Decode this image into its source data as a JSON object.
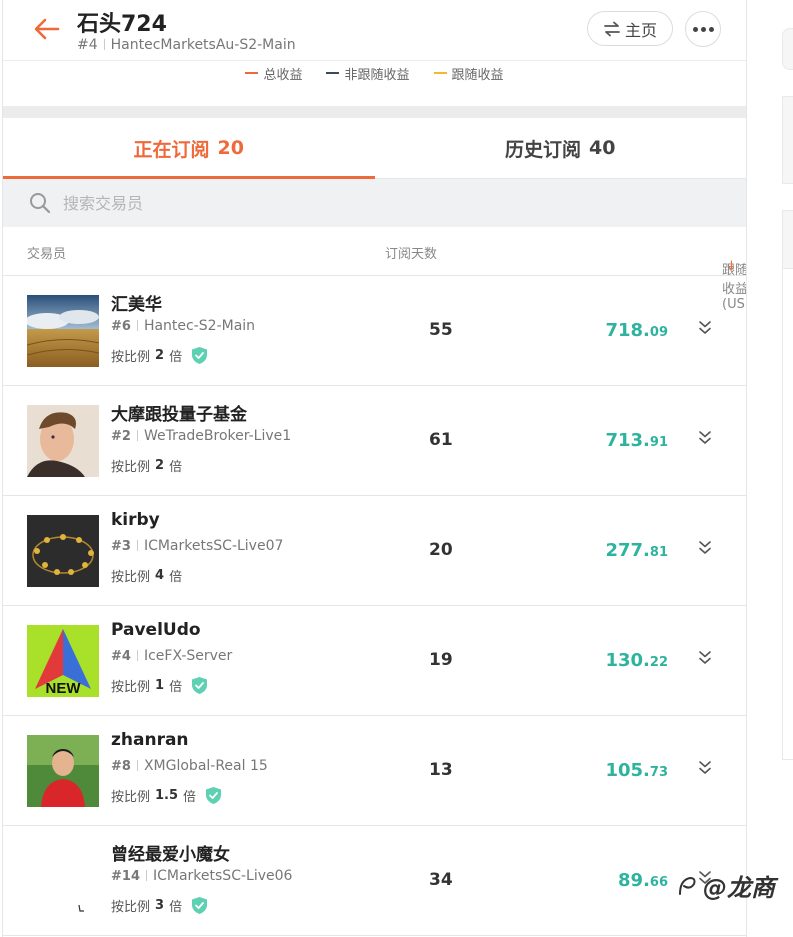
{
  "header": {
    "title": "石头724",
    "rank": "#4",
    "server": "HantecMarketsAu-S2-Main",
    "home_label": "主页"
  },
  "legend": [
    {
      "label": "总收益",
      "color": "#ef6a3a"
    },
    {
      "label": "非跟随收益",
      "color": "#3d4a5c"
    },
    {
      "label": "跟随收益",
      "color": "#f5b72e"
    }
  ],
  "tabs": [
    {
      "label": "正在订阅",
      "count": "20",
      "active": true
    },
    {
      "label": "历史订阅",
      "count": "40",
      "active": false
    }
  ],
  "search": {
    "placeholder": "搜索交易员"
  },
  "columns": {
    "trader": "交易员",
    "days": "订阅天数",
    "profit": "跟随收益 (USD)",
    "sort_arrow": "↓"
  },
  "rows": [
    {
      "name": "汇美华",
      "rank": "#6",
      "server": "Hantec-S2-Main",
      "ratio_prefix": "按比例",
      "ratio": "2",
      "ratio_suffix": "倍",
      "verified": true,
      "days": "55",
      "profit_int": "718.",
      "profit_dec": "09",
      "avatar": "wheat-field"
    },
    {
      "name": "大摩跟投量子基金",
      "rank": "#2",
      "server": "WeTradeBroker-Live1",
      "ratio_prefix": "按比例",
      "ratio": "2",
      "ratio_suffix": "倍",
      "verified": false,
      "days": "61",
      "profit_int": "713.",
      "profit_dec": "91",
      "avatar": "man-portrait"
    },
    {
      "name": "kirby",
      "rank": "#3",
      "server": "ICMarketsSC-Live07",
      "ratio_prefix": "按比例",
      "ratio": "4",
      "ratio_suffix": "倍",
      "verified": false,
      "days": "20",
      "profit_int": "277.",
      "profit_dec": "81",
      "avatar": "gold-pendants"
    },
    {
      "name": "PavelUdo",
      "rank": "#4",
      "server": "IceFX-Server",
      "ratio_prefix": "按比例",
      "ratio": "1",
      "ratio_suffix": "倍",
      "verified": true,
      "days": "19",
      "profit_int": "130.",
      "profit_dec": "22",
      "avatar": "new-triangle",
      "avatar_text": "NEW"
    },
    {
      "name": "zhanran",
      "rank": "#8",
      "server": "XMGlobal-Real 15",
      "ratio_prefix": "按比例",
      "ratio": "1.5",
      "ratio_suffix": "倍",
      "verified": true,
      "days": "13",
      "profit_int": "105.",
      "profit_dec": "73",
      "avatar": "man-red-shirt"
    },
    {
      "name": "曾经最爱小魔女",
      "rank": "#14",
      "server": "ICMarketsSC-Live06",
      "ratio_prefix": "按比例",
      "ratio": "3",
      "ratio_suffix": "倍",
      "verified": true,
      "days": "34",
      "profit_int": "89.",
      "profit_dec": "66",
      "avatar": "blank"
    }
  ],
  "watermark": {
    "text": "@龙商"
  }
}
